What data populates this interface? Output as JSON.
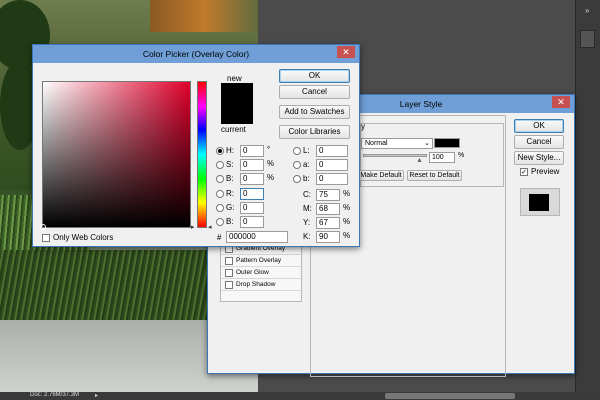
{
  "canvas": {
    "status": "Doc: 2.76M/37.3M"
  },
  "layer_style": {
    "title": "Layer Style",
    "ok": "OK",
    "cancel": "Cancel",
    "new_style": "New Style...",
    "preview_label": "Preview",
    "preview_checked": true,
    "blend_mode": "Normal",
    "opacity": "100",
    "opacity_unit": "%",
    "make_default": "Make Default",
    "reset_default": "Reset to Default",
    "header_fragment": "y",
    "styles": [
      {
        "label": "Gradient Overlay",
        "checked": false
      },
      {
        "label": "Pattern Overlay",
        "checked": false
      },
      {
        "label": "Outer Glow",
        "checked": false
      },
      {
        "label": "Drop Shadow",
        "checked": false
      }
    ]
  },
  "color_picker": {
    "title": "Color Picker (Overlay Color)",
    "ok": "OK",
    "cancel": "Cancel",
    "add_to_swatches": "Add to Swatches",
    "color_libraries": "Color Libraries",
    "new_label": "new",
    "current_label": "current",
    "new_color": "#000000",
    "current_color": "#000000",
    "only_web_colors": "Only Web Colors",
    "hex_label": "#",
    "hex": "000000",
    "hsb": [
      {
        "label": "H:",
        "value": "0",
        "unit": "°",
        "selected": true
      },
      {
        "label": "S:",
        "value": "0",
        "unit": "%",
        "selected": false
      },
      {
        "label": "B:",
        "value": "0",
        "unit": "%",
        "selected": false
      }
    ],
    "rgb": [
      {
        "label": "R:",
        "value": "0",
        "selected": false
      },
      {
        "label": "G:",
        "value": "0",
        "selected": false
      },
      {
        "label": "B:",
        "value": "0",
        "selected": false
      }
    ],
    "lab": [
      {
        "label": "L:",
        "value": "0"
      },
      {
        "label": "a:",
        "value": "0"
      },
      {
        "label": "b:",
        "value": "0"
      }
    ],
    "cmyk": [
      {
        "label": "C:",
        "value": "75",
        "unit": "%"
      },
      {
        "label": "M:",
        "value": "68",
        "unit": "%"
      },
      {
        "label": "Y:",
        "value": "67",
        "unit": "%"
      },
      {
        "label": "K:",
        "value": "90",
        "unit": "%"
      }
    ]
  }
}
